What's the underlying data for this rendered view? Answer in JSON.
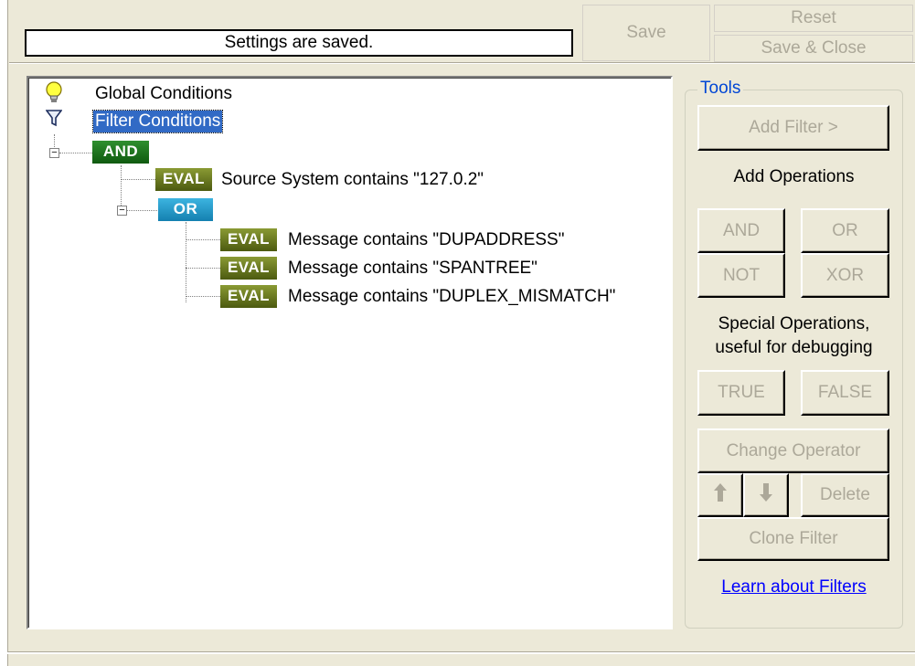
{
  "status": {
    "message": "Settings are saved."
  },
  "header_buttons": {
    "save": "Save",
    "reset": "Reset",
    "save_close": "Save & Close"
  },
  "tree": {
    "global_conditions": "Global Conditions",
    "filter_conditions": "Filter Conditions",
    "and_label": "AND",
    "or_label": "OR",
    "eval_label": "EVAL",
    "expander": "−",
    "conditions": [
      "Source System contains \"127.0.2\"",
      "Message contains \"DUPADDRESS\"",
      "Message contains \"SPANTREE\"",
      "Message contains \"DUPLEX_MISMATCH\""
    ]
  },
  "tools": {
    "legend": "Tools",
    "add_filter": "Add Filter >",
    "add_operations": "Add Operations",
    "and": "AND",
    "or": "OR",
    "not": "NOT",
    "xor": "XOR",
    "special_operations_line1": "Special Operations,",
    "special_operations_line2": "useful for debugging",
    "true": "TRUE",
    "false": "FALSE",
    "change_operator": "Change Operator",
    "delete": "Delete",
    "clone_filter": "Clone Filter",
    "learn_link": "Learn about Filters"
  },
  "icons": {
    "global": "lightbulb-icon",
    "filter": "funnel-icon",
    "up": "arrow-up-icon",
    "down": "arrow-down-icon"
  },
  "colors": {
    "and_badge": "#1a6e1a",
    "or_badge": "#2a9fd0",
    "eval_badge": "#5b6b1a",
    "selection": "#316ac5",
    "link": "#0000ff"
  }
}
